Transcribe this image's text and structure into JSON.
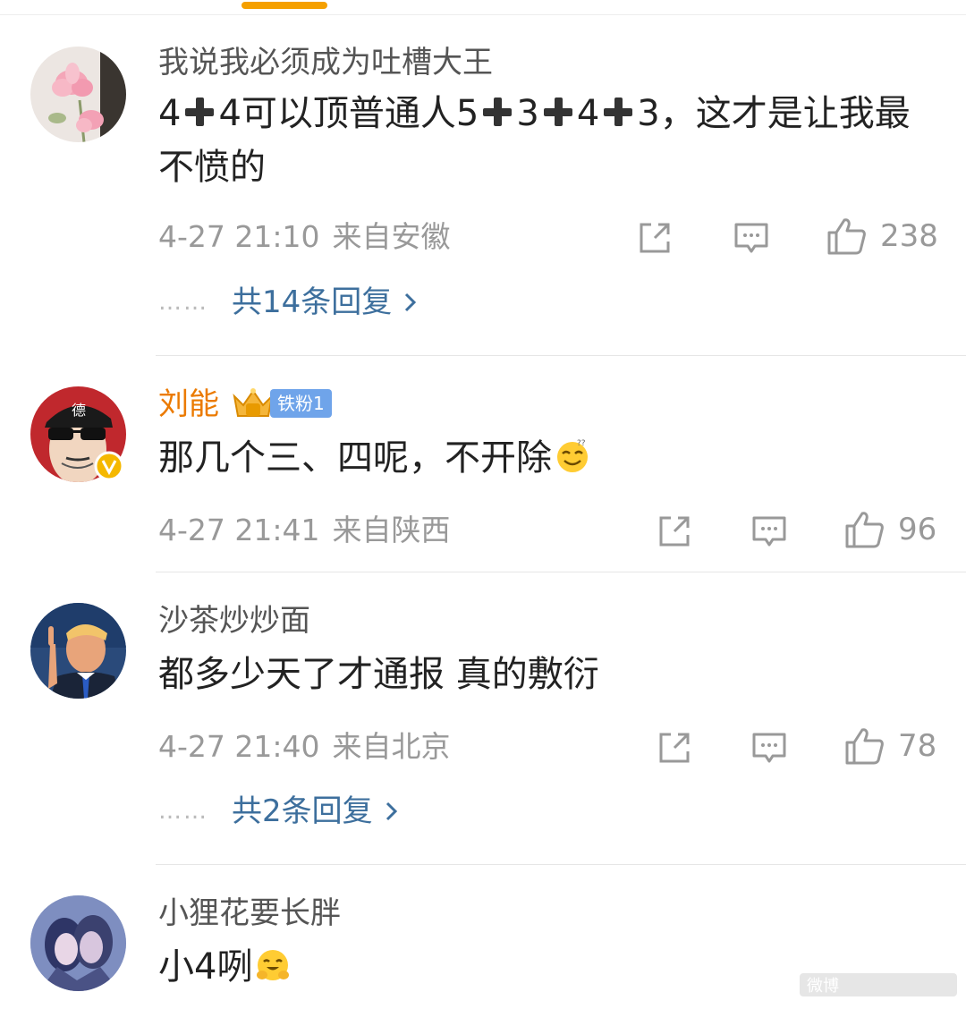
{
  "colors": {
    "accent": "#f5a000",
    "link": "#3d6f9d",
    "vip_name": "#eb7a00",
    "meta": "#999999"
  },
  "comments": [
    {
      "username": "我说我必须成为吐槽大王",
      "content_parts": [
        "4",
        "4可以顶普通人5",
        "3",
        "4",
        "3，这才是让我最不愤的"
      ],
      "time": "4-27 21:10",
      "location": "来自安徽",
      "likes": "238",
      "replies": "共14条回复",
      "avatar_icon": "lotus-flower-avatar"
    },
    {
      "username": "刘能",
      "badge": "铁粉1",
      "content": "那几个三、四呢，不开除",
      "emoji": "sweat-smile-emoji",
      "time": "4-27 21:41",
      "location": "来自陕西",
      "likes": "96",
      "avatar_icon": "cartoon-man-sunglasses-avatar"
    },
    {
      "username": "沙茶炒炒面",
      "content": "都多少天了才通报 真的敷衍",
      "time": "4-27 21:40",
      "location": "来自北京",
      "likes": "78",
      "replies": "共2条回复",
      "avatar_icon": "man-pointing-avatar"
    },
    {
      "username": "小狸花要长胖",
      "content": "小4咧",
      "emoji": "hug-emoji",
      "avatar_icon": "anime-couple-avatar"
    }
  ],
  "reply_dots": "……",
  "watermark": "微博"
}
